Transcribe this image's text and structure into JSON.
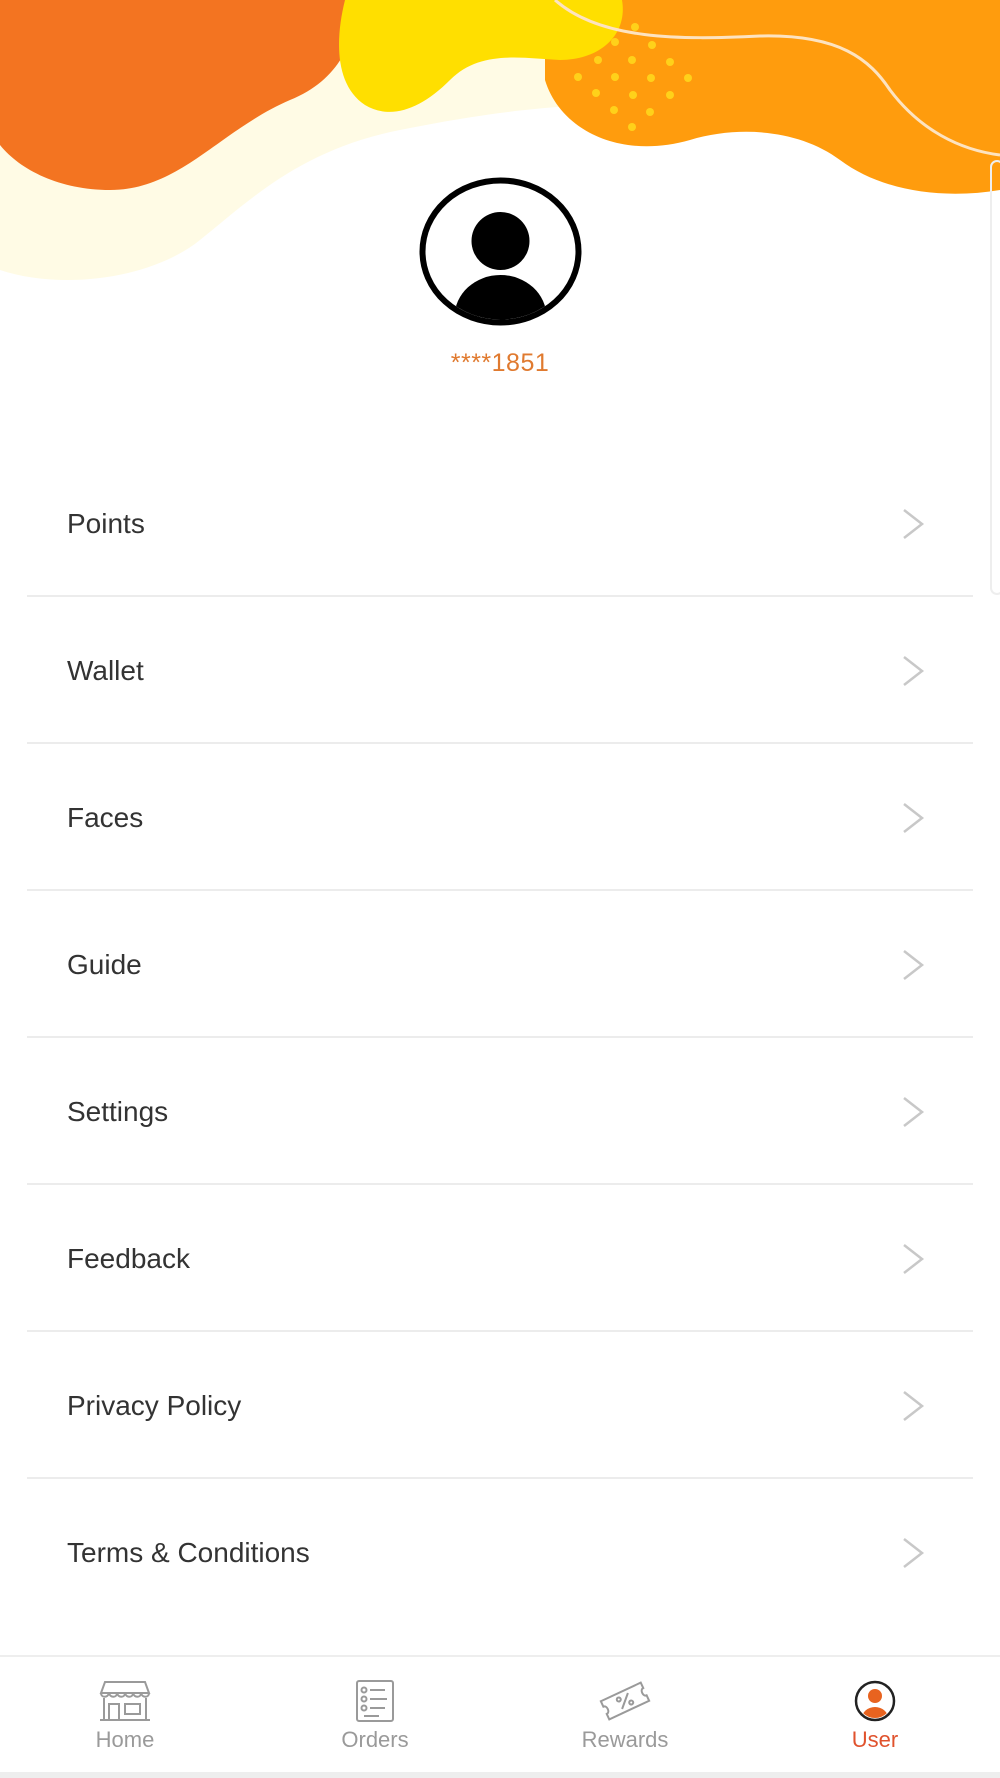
{
  "profile": {
    "masked_phone": "****1851",
    "avatar_icon": "user-avatar-icon"
  },
  "menu": {
    "chevron_icon": "chevron-right-icon",
    "items": [
      {
        "label": "Points"
      },
      {
        "label": "Wallet"
      },
      {
        "label": "Faces"
      },
      {
        "label": "Guide"
      },
      {
        "label": "Settings"
      },
      {
        "label": "Feedback"
      },
      {
        "label": "Privacy Policy"
      },
      {
        "label": "Terms & Conditions"
      }
    ]
  },
  "tabs": [
    {
      "label": "Home",
      "icon": "store-icon",
      "active": false
    },
    {
      "label": "Orders",
      "icon": "order-list-icon",
      "active": false
    },
    {
      "label": "Rewards",
      "icon": "coupon-ticket-icon",
      "active": false
    },
    {
      "label": "User",
      "icon": "user-icon",
      "active": true
    }
  ],
  "colors": {
    "accent": "#e0522d",
    "phone_text": "#e07a2f",
    "wave_orange_dark": "#f37421",
    "wave_orange": "#ff9c0d",
    "wave_yellow": "#ffdf00",
    "wave_cream": "#fffbe5"
  }
}
